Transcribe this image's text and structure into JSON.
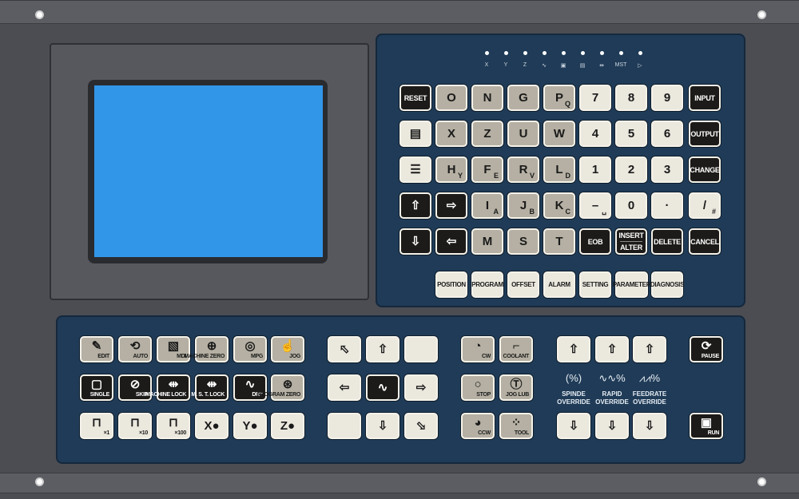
{
  "colors": {
    "panel": "#1f3b57",
    "screen": "#3196e8",
    "key_gray": "#b5b0a3",
    "key_light": "#ebe8de",
    "key_black": "#1d1b19"
  },
  "indicators": [
    {
      "label": "X"
    },
    {
      "label": "Y"
    },
    {
      "label": "Z"
    },
    {
      "label": "∿"
    },
    {
      "label": "▣"
    },
    {
      "label": "▤"
    },
    {
      "label": "⇹"
    },
    {
      "label": "MST"
    },
    {
      "label": "▷"
    }
  ],
  "keypad": {
    "rows": [
      [
        {
          "label": "RESET",
          "style": "black",
          "small": true
        },
        {
          "label": "O",
          "style": "gray"
        },
        {
          "label": "N",
          "style": "gray"
        },
        {
          "label": "G",
          "style": "gray"
        },
        {
          "label": "P",
          "sub": "Q",
          "style": "gray"
        },
        {
          "label": "7",
          "style": "light"
        },
        {
          "label": "8",
          "style": "light"
        },
        {
          "label": "9",
          "style": "light"
        },
        {
          "label": "INPUT",
          "style": "black",
          "small": true
        }
      ],
      [
        {
          "icon": "page-icon",
          "glyph": "▤",
          "style": "light"
        },
        {
          "label": "X",
          "style": "gray"
        },
        {
          "label": "Z",
          "style": "gray"
        },
        {
          "label": "U",
          "style": "gray"
        },
        {
          "label": "W",
          "style": "gray"
        },
        {
          "label": "4",
          "style": "light"
        },
        {
          "label": "5",
          "style": "light"
        },
        {
          "label": "6",
          "style": "light"
        },
        {
          "label": "OUTPUT",
          "style": "black",
          "small": true
        }
      ],
      [
        {
          "icon": "page-list-icon",
          "glyph": "☰",
          "style": "light"
        },
        {
          "label": "H",
          "sub": "Y",
          "style": "gray"
        },
        {
          "label": "F",
          "sub": "E",
          "style": "gray"
        },
        {
          "label": "R",
          "sub": "V",
          "style": "gray"
        },
        {
          "label": "L",
          "sub": "D",
          "style": "gray"
        },
        {
          "label": "1",
          "style": "light"
        },
        {
          "label": "2",
          "style": "light"
        },
        {
          "label": "3",
          "style": "light"
        },
        {
          "label": "CHANGE",
          "style": "black",
          "small": true
        }
      ],
      [
        {
          "icon": "shift-up-icon",
          "glyph": "⇧",
          "style": "black"
        },
        {
          "icon": "cursor-right-icon",
          "glyph": "⇨",
          "style": "black"
        },
        {
          "label": "I",
          "sub": "A",
          "style": "gray"
        },
        {
          "label": "J",
          "sub": "B",
          "style": "gray"
        },
        {
          "label": "K",
          "sub": "C",
          "style": "gray"
        },
        {
          "label": "–",
          "sub": "␣",
          "style": "light"
        },
        {
          "label": "0",
          "style": "light"
        },
        {
          "label": "·",
          "style": "light"
        },
        {
          "label": "/",
          "sub": "#",
          "style": "light"
        }
      ],
      [
        {
          "icon": "shift-down-icon",
          "glyph": "⇩",
          "style": "black"
        },
        {
          "icon": "cursor-left-icon",
          "glyph": "⇦",
          "style": "black"
        },
        {
          "label": "M",
          "style": "gray"
        },
        {
          "label": "S",
          "style": "gray"
        },
        {
          "label": "T",
          "style": "gray"
        },
        {
          "label": "EOB",
          "style": "black",
          "small": true
        },
        {
          "label": "INSERT",
          "sub2": "ALTER",
          "style": "black",
          "small": true
        },
        {
          "label": "DELETE",
          "style": "black",
          "small": true
        },
        {
          "label": "CANCEL",
          "style": "black",
          "small": true
        }
      ]
    ],
    "function_keys": [
      "POSITION",
      "PROGRAM",
      "OFFSET",
      "ALARM",
      "SETTING",
      "PARAMETER",
      "DIAGNOSIS"
    ]
  },
  "operator": {
    "mode_rows": [
      [
        {
          "cap": "EDIT",
          "glyph": "✎",
          "style": "gray"
        },
        {
          "cap": "AUTO",
          "glyph": "⟲",
          "style": "gray"
        },
        {
          "cap": "MDI",
          "glyph": "▧",
          "style": "gray"
        },
        {
          "cap": "MACHINE ZERO",
          "glyph": "⊕",
          "style": "gray"
        },
        {
          "cap": "MPG",
          "glyph": "◎",
          "style": "gray"
        },
        {
          "cap": "JOG",
          "glyph": "☝",
          "style": "gray"
        }
      ],
      [
        {
          "cap": "SINGLE",
          "glyph": "▢",
          "style": "black"
        },
        {
          "cap": "SKIP",
          "glyph": "⊘",
          "style": "black"
        },
        {
          "cap": "MACHINE LOCK",
          "glyph": "⇹",
          "style": "black"
        },
        {
          "cap": "M. S. T. LOCK",
          "glyph": "⇹",
          "style": "black"
        },
        {
          "cap": "DRY",
          "glyph": "∿",
          "style": "black"
        },
        {
          "cap": "PROGRAM ZERO",
          "glyph": "⊛",
          "style": "gray"
        }
      ],
      [
        {
          "cap": "×1",
          "glyph": "⊓",
          "style": "light"
        },
        {
          "cap": "×10",
          "glyph": "⊓",
          "style": "light"
        },
        {
          "cap": "×100",
          "glyph": "⊓",
          "style": "light"
        },
        {
          "cap": "",
          "glyph": "X●",
          "style": "light"
        },
        {
          "cap": "",
          "glyph": "Y●",
          "style": "light"
        },
        {
          "cap": "",
          "glyph": "Z●",
          "style": "light"
        }
      ]
    ],
    "jog_rows": [
      [
        {
          "glyph": "⬁",
          "name": "jog-up-left"
        },
        {
          "glyph": "⇧",
          "name": "jog-plus-x"
        },
        {
          "glyph": "",
          "name": "jog-blank"
        }
      ],
      [
        {
          "glyph": "⇦",
          "name": "jog-left"
        },
        {
          "glyph": "∿",
          "name": "jog-rapid",
          "style": "black"
        },
        {
          "glyph": "⇨",
          "name": "jog-right"
        }
      ],
      [
        {
          "glyph": "",
          "name": "jog-blank"
        },
        {
          "glyph": "⇩",
          "name": "jog-minus-x"
        },
        {
          "glyph": "⬂",
          "name": "jog-down-right"
        }
      ]
    ],
    "spindle_rows": [
      [
        {
          "cap": "CW",
          "glyph": "◔"
        },
        {
          "cap": "COOLANT",
          "glyph": "⌐"
        }
      ],
      [
        {
          "cap": "STOP",
          "glyph": "○"
        },
        {
          "cap": "JOG LUB",
          "glyph": "Ⓣ"
        }
      ],
      [
        {
          "cap": "CCW",
          "glyph": "◕"
        },
        {
          "cap": "TOOL",
          "glyph": "⁘"
        }
      ]
    ],
    "overrides": [
      {
        "icon": "(%)",
        "line1": "SPINDE",
        "line2": "OVERRIDE"
      },
      {
        "icon": "∿∿%",
        "line1": "RAPID",
        "line2": "OVERRIDE"
      },
      {
        "icon": "⩘⩘%",
        "line1": "FEEDRATE",
        "line2": "OVERRIDE"
      }
    ],
    "pause": "PAUSE",
    "run": "RUN"
  }
}
